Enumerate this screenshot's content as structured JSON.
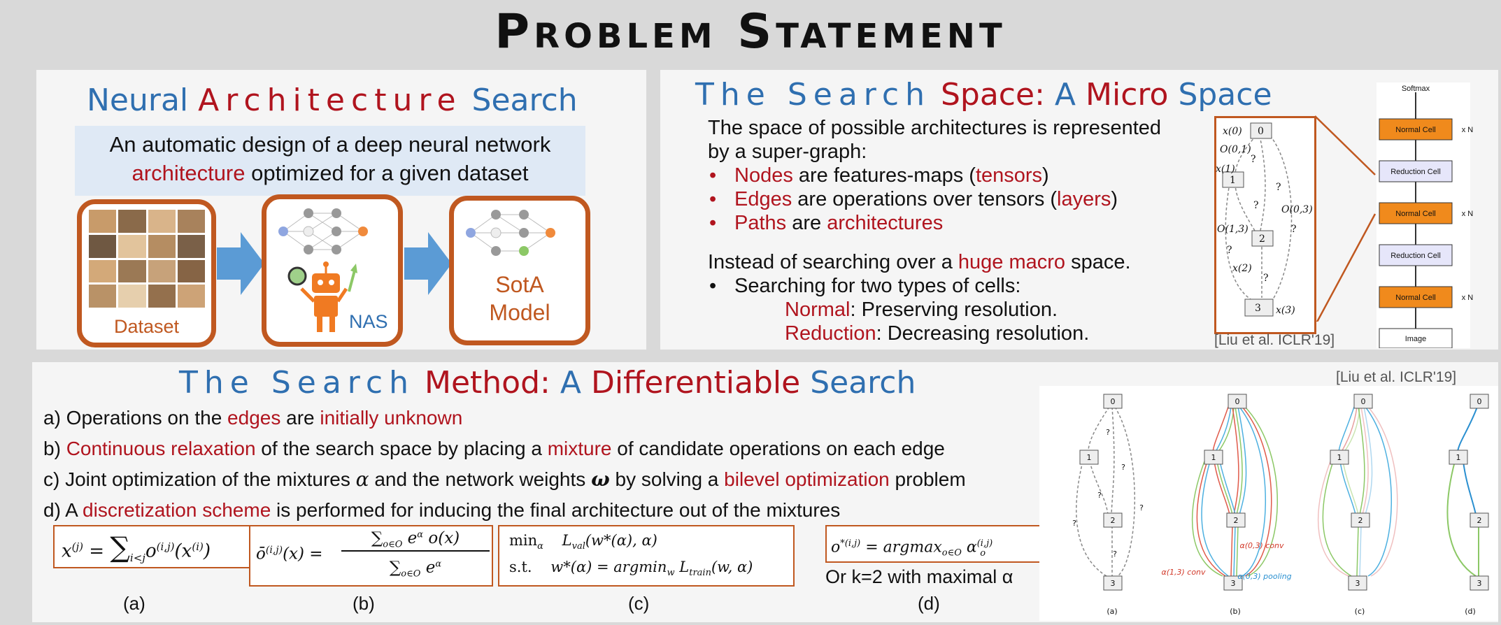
{
  "title": "Problem Statement",
  "nas": {
    "heading": {
      "w1": "Neural",
      "w2": "Architecture",
      "w3": "Search"
    },
    "definition": {
      "line1": "An automatic design of a deep neural network",
      "word_arch": "architecture",
      "line2_rest": " optimized for a given dataset"
    },
    "dataset_label": "Dataset",
    "nas_label": "NAS",
    "model_label1": "SotA",
    "model_label2": "Model"
  },
  "space": {
    "heading": {
      "w1": "The Search",
      "w2": "Space:",
      "w3": "A",
      "w4": "Micro",
      "w5": "Space"
    },
    "intro1": "The space of possible architectures is represented",
    "intro2": "by a super-graph:",
    "bullets": [
      {
        "a": "Nodes",
        "b": " are features-maps (",
        "c": "tensors",
        "d": ")"
      },
      {
        "a": "Edges",
        "b": " are operations over tensors (",
        "c": "layers",
        "d": ")"
      },
      {
        "a": "Paths",
        "b": " are ",
        "c": "architectures",
        "d": ""
      }
    ],
    "instead": {
      "a": "Instead of searching over a ",
      "b": "huge macro",
      "c": " space."
    },
    "cells_bullet": "Searching for two types of cells:",
    "normal": {
      "a": "Normal",
      "b": ": Preserving resolution."
    },
    "reduction": {
      "a": "Reduction",
      "b": ": Decreasing resolution."
    },
    "citation": "[Liu et al. ICLR'19]",
    "graph": {
      "nodes": [
        "0",
        "1",
        "2",
        "3"
      ],
      "labels": [
        "x(0)",
        "x(1)",
        "x(2)",
        "x(3)",
        "O(0,1)",
        "O(0,3)",
        "O(1,3)"
      ],
      "q": "?"
    },
    "stack": {
      "softmax": "Softmax",
      "normal": "Normal Cell",
      "reduction": "Reduction Cell",
      "image": "Image",
      "xn": "x N"
    }
  },
  "method": {
    "heading": {
      "w1": "The Search",
      "w2": "Method:",
      "w3": "A",
      "w4": "Differentiable",
      "w5": "Search"
    },
    "citation": "[Liu et al. ICLR'19]",
    "a": {
      "p1": "a) Operations on the ",
      "r1": "edges",
      "p2": " are ",
      "r2": "initially unknown"
    },
    "b": {
      "p1": "b) ",
      "r1": "Continuous relaxation",
      "p2": " of the search space by placing a ",
      "r2": "mixture",
      "p3": " of candidate operations on each edge"
    },
    "c": {
      "p1": "c) Joint optimization of the mixtures ",
      "alpha": "α",
      "p2": " and the network weights ",
      "omega": "ω",
      "p3": " by solving a ",
      "r1": "bilevel optimization",
      "p4": " problem"
    },
    "d": {
      "p1": "d) A ",
      "r1": "discretization scheme",
      "p2": " is performed for inducing the final architecture out of the mixtures"
    },
    "eq_captions": [
      "(a)",
      "(b)",
      "(c)",
      "(d)"
    ],
    "eq_d_note": "Or k=2 with maximal α",
    "eq": {
      "a_lhs": "x",
      "a_sup": "(j)",
      "a_eq": " = ",
      "a_sum": "∑",
      "a_sub": "i<j",
      "a_o": "o",
      "a_osup": "(i,j)",
      "a_x": "(x",
      "a_xsup": "(i)",
      "a_close": ")",
      "b_lhs": "ō",
      "b_sup": "(i,j)",
      "b_x": "(x)",
      "b_eq": " = ",
      "b_num": "∑",
      "b_num_sub": "o∈O",
      "b_num_e": " e",
      "b_num_esup": "α",
      "b_num_o": "o(x)",
      "b_den": "∑",
      "b_den_sub": "o∈O",
      "b_den_e": " e",
      "b_den_esup": "α",
      "c_min": "min",
      "c_min_sub": "α",
      "c_l1": "L",
      "c_l1_sub": "val",
      "c_l1_rest": "(w*(α), α)",
      "c_st": "s.t.",
      "c_l2": "w*(α) = argmin",
      "c_l2_sub": "w",
      "c_l2_L": "L",
      "c_l2_Lsub": "train",
      "c_l2_rest": "(w, α)",
      "d_lhs": "o",
      "d_sup": "*(i,j)",
      "d_eq": " = argmax",
      "d_sub": "o∈O",
      "d_alpha": " α",
      "d_alpha_sup": "(i,j)",
      "d_alpha_sub": "o"
    },
    "cells_captions": [
      "(a)",
      "(b)",
      "(c)",
      "(d)"
    ],
    "cell_nodes": [
      "0",
      "1",
      "2",
      "3"
    ],
    "cell_labels": {
      "conv13": "α(1,3) conv",
      "conv03": "α(0,3) conv",
      "pool03": "α(0,3) pooling"
    },
    "q": "?"
  },
  "colors": {
    "blue": "#2f6fb0",
    "red": "#b0141e",
    "orange": "#c05820",
    "cell_orange": "#f08a1c",
    "cell_lav": "#e6e6fa"
  }
}
